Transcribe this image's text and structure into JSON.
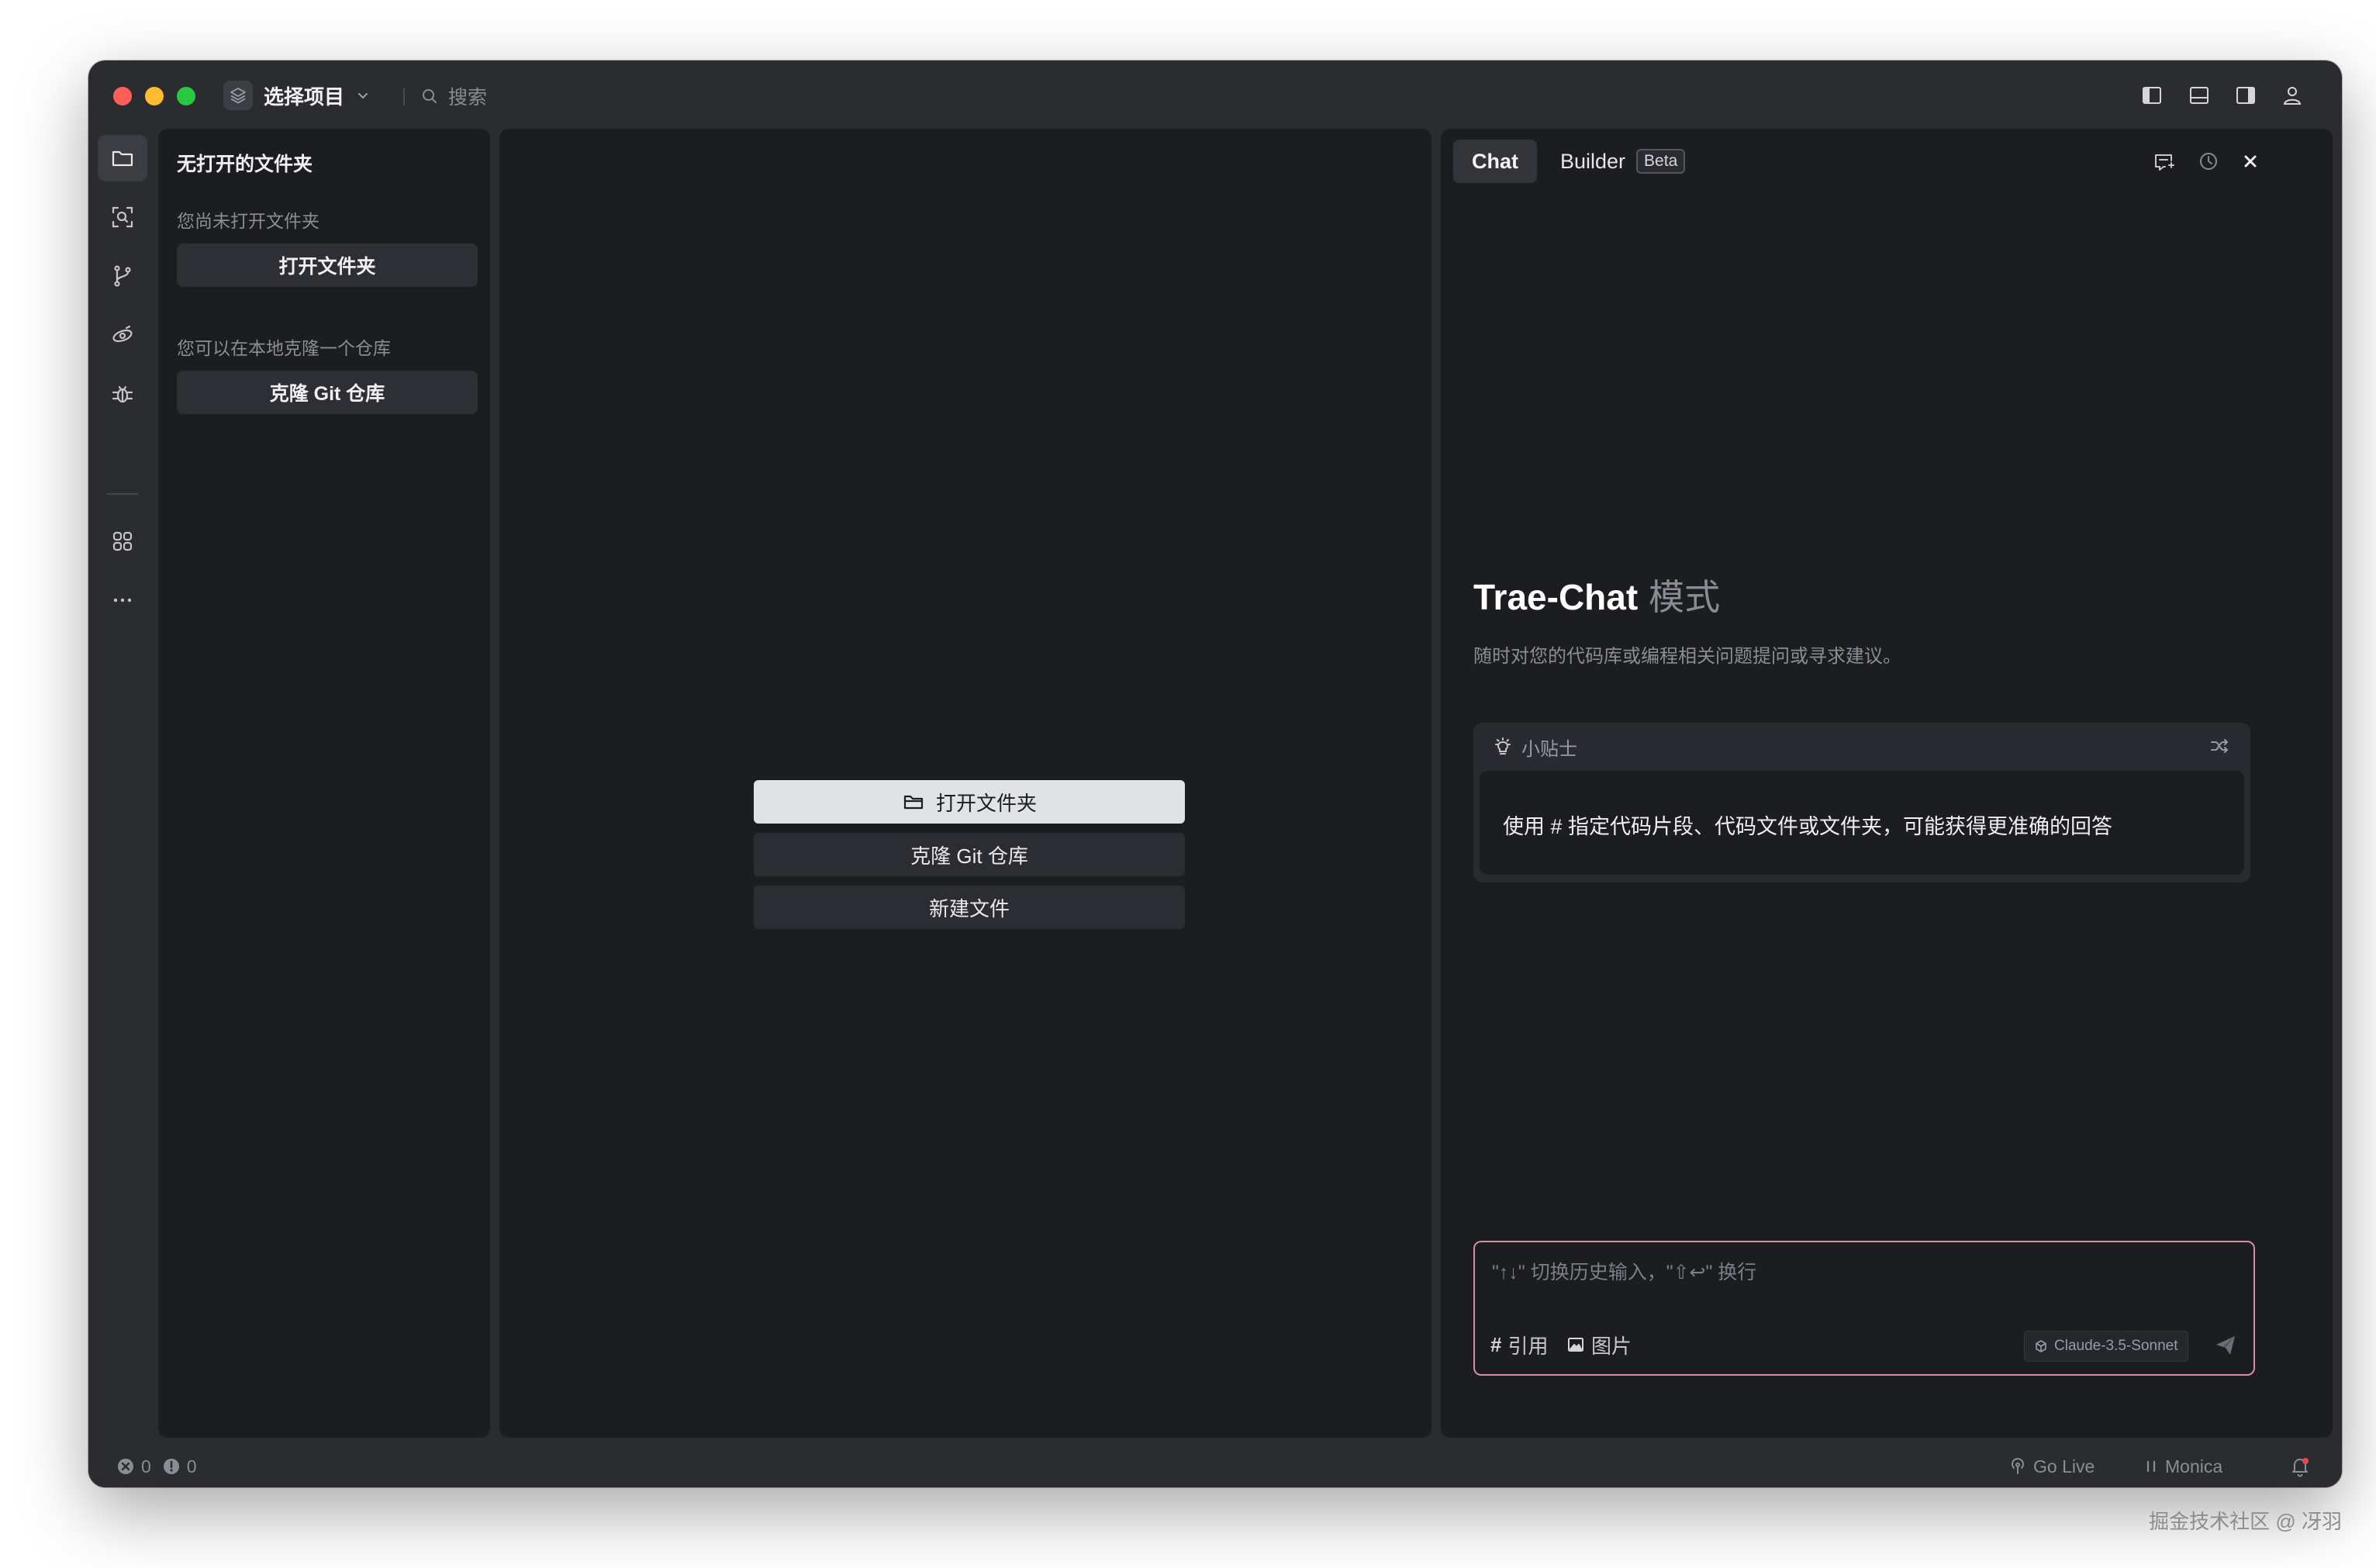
{
  "titlebar": {
    "project_label": "选择项目",
    "search_placeholder": "搜索"
  },
  "explorer": {
    "title": "无打开的文件夹",
    "no_folder_hint": "您尚未打开文件夹",
    "open_folder_button": "打开文件夹",
    "clone_hint": "您可以在本地克隆一个仓库",
    "clone_button": "克隆 Git 仓库"
  },
  "editor": {
    "open_folder": "打开文件夹",
    "clone_repo": "克隆 Git 仓库",
    "new_file": "新建文件"
  },
  "chat": {
    "tabs": [
      {
        "label": "Chat",
        "active": true
      },
      {
        "label": "Builder",
        "badge": "Beta"
      }
    ],
    "heading_main": "Trae-Chat",
    "heading_mode": "模式",
    "subtitle": "随时对您的代码库或编程相关问题提问或寻求建议。",
    "tips": {
      "label": "小贴士",
      "text": "使用 # 指定代码片段、代码文件或文件夹，可能获得更准确的回答"
    },
    "input": {
      "placeholder": "\"↑↓\" 切换历史输入，\"⇧↩\" 换行",
      "reference_label": "引用",
      "image_label": "图片",
      "model": "Claude-3.5-Sonnet"
    }
  },
  "statusbar": {
    "errors": "0",
    "warnings": "0",
    "go_live": "Go Live",
    "monica": "Monica"
  },
  "watermark": "掘金技术社区 @ 冴羽",
  "colors": {
    "window_bg": "#2b2c30",
    "panel_bg": "#1c1d21",
    "input_border": "#d98fa0",
    "primary_button": "#e1e2e6"
  }
}
